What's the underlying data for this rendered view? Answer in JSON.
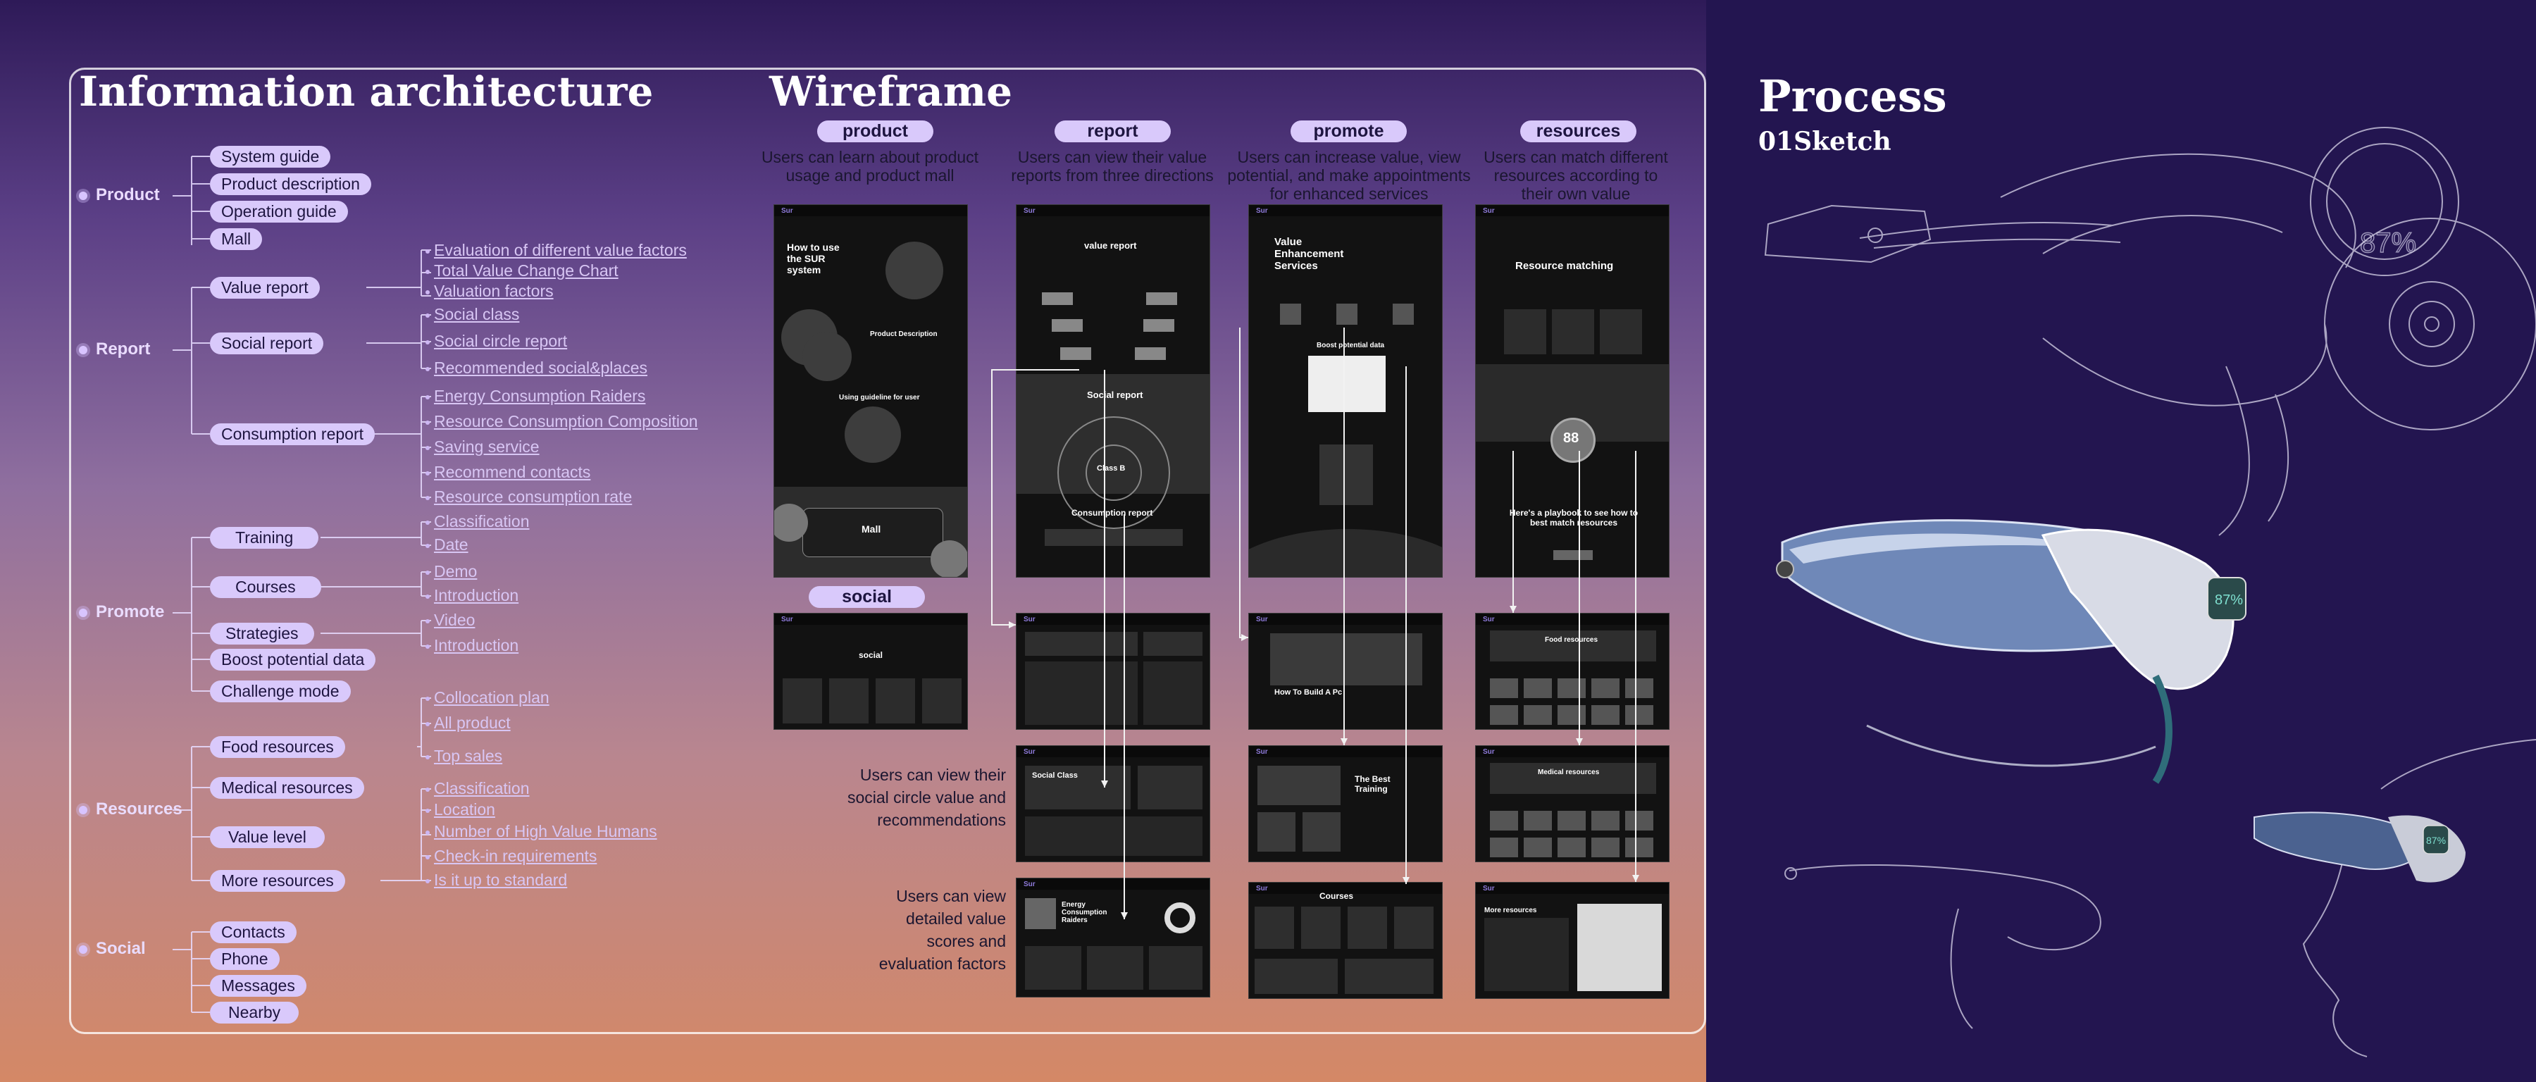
{
  "titles": {
    "ia": "Information architecture",
    "wireframe": "Wireframe",
    "process": "Process",
    "process_sub": "01Sketch"
  },
  "ia": {
    "categories": [
      {
        "label": "Product",
        "children": [
          "System guide",
          "Product description",
          "Operation guide",
          "Mall"
        ]
      },
      {
        "label": "Report",
        "children": [
          "Value report",
          "Social report",
          "Consumption report"
        ]
      },
      {
        "label": "Promote",
        "children": [
          "Training",
          "Courses",
          "Strategies",
          "Boost potential data",
          "Challenge mode"
        ]
      },
      {
        "label": "Resources",
        "children": [
          "Food resources",
          "Medical resources",
          "Value level",
          "More resources"
        ]
      },
      {
        "label": "Social",
        "children": [
          "Contacts",
          "Phone",
          "Messages",
          "Nearby"
        ]
      }
    ],
    "leaves": [
      "Evaluation of different value factors",
      "Total Value Change Chart",
      "Valuation factors",
      "Social class",
      "Social circle report",
      "Recommended social&places",
      "Energy Consumption Raiders",
      "Resource Consumption Composition",
      "Saving service",
      "Recommend contacts",
      "Resource consumption rate",
      "Classification",
      "Date",
      "Demo",
      "Introduction",
      "Video",
      "Introduction",
      "Collocation plan",
      "All product",
      "Top sales",
      "Classification",
      "Location",
      "Number of High Value Humans",
      "Check-in requirements",
      "Is it up to standard"
    ]
  },
  "wireframe": {
    "columns": [
      {
        "label": "product",
        "desc": [
          "Users can learn about product",
          "usage and product mall"
        ]
      },
      {
        "label": "report",
        "desc": [
          "Users can view their value",
          "reports from three directions"
        ]
      },
      {
        "label": "promote",
        "desc": [
          "Users can increase value, view",
          "potential, and make appointments",
          "for enhanced services"
        ]
      },
      {
        "label": "resources",
        "desc": [
          "Users can match different",
          "resources according to",
          "their own value"
        ]
      }
    ],
    "social_label": "social",
    "notes": [
      [
        "Users can view their",
        "social circle value and",
        "recommendations"
      ],
      [
        "Users can view",
        "detailed value",
        "scores and",
        "evaluation factors"
      ]
    ],
    "screens": {
      "logo": "Sur",
      "product_hero": "How to use the SUR system",
      "product_desc": "Product Description",
      "product_guide": "Using guideline for user",
      "product_mall": "Mall",
      "value_report": "value report",
      "social_report": "Social report",
      "class_b": "Class B",
      "consumption_report": "Consumption report",
      "value_enh": "Value Enhancement Services",
      "boost": "Boost potential data",
      "resource_matching": "Resource matching",
      "playbook": "Here's a playbook to see how to best match resources",
      "score": "88",
      "social": "social",
      "build": "How To Build A Pc",
      "food_resources": "Food resources",
      "social_class": "Social Class",
      "best_training": "The Best Training",
      "medical_resources": "Medical resources",
      "energy": "Energy Consumption Raiders",
      "courses": "Courses",
      "more_resources": "More resources"
    }
  },
  "sketch": {
    "hud_a": "87%",
    "hud_b": "87%",
    "hud_c": "87%"
  }
}
